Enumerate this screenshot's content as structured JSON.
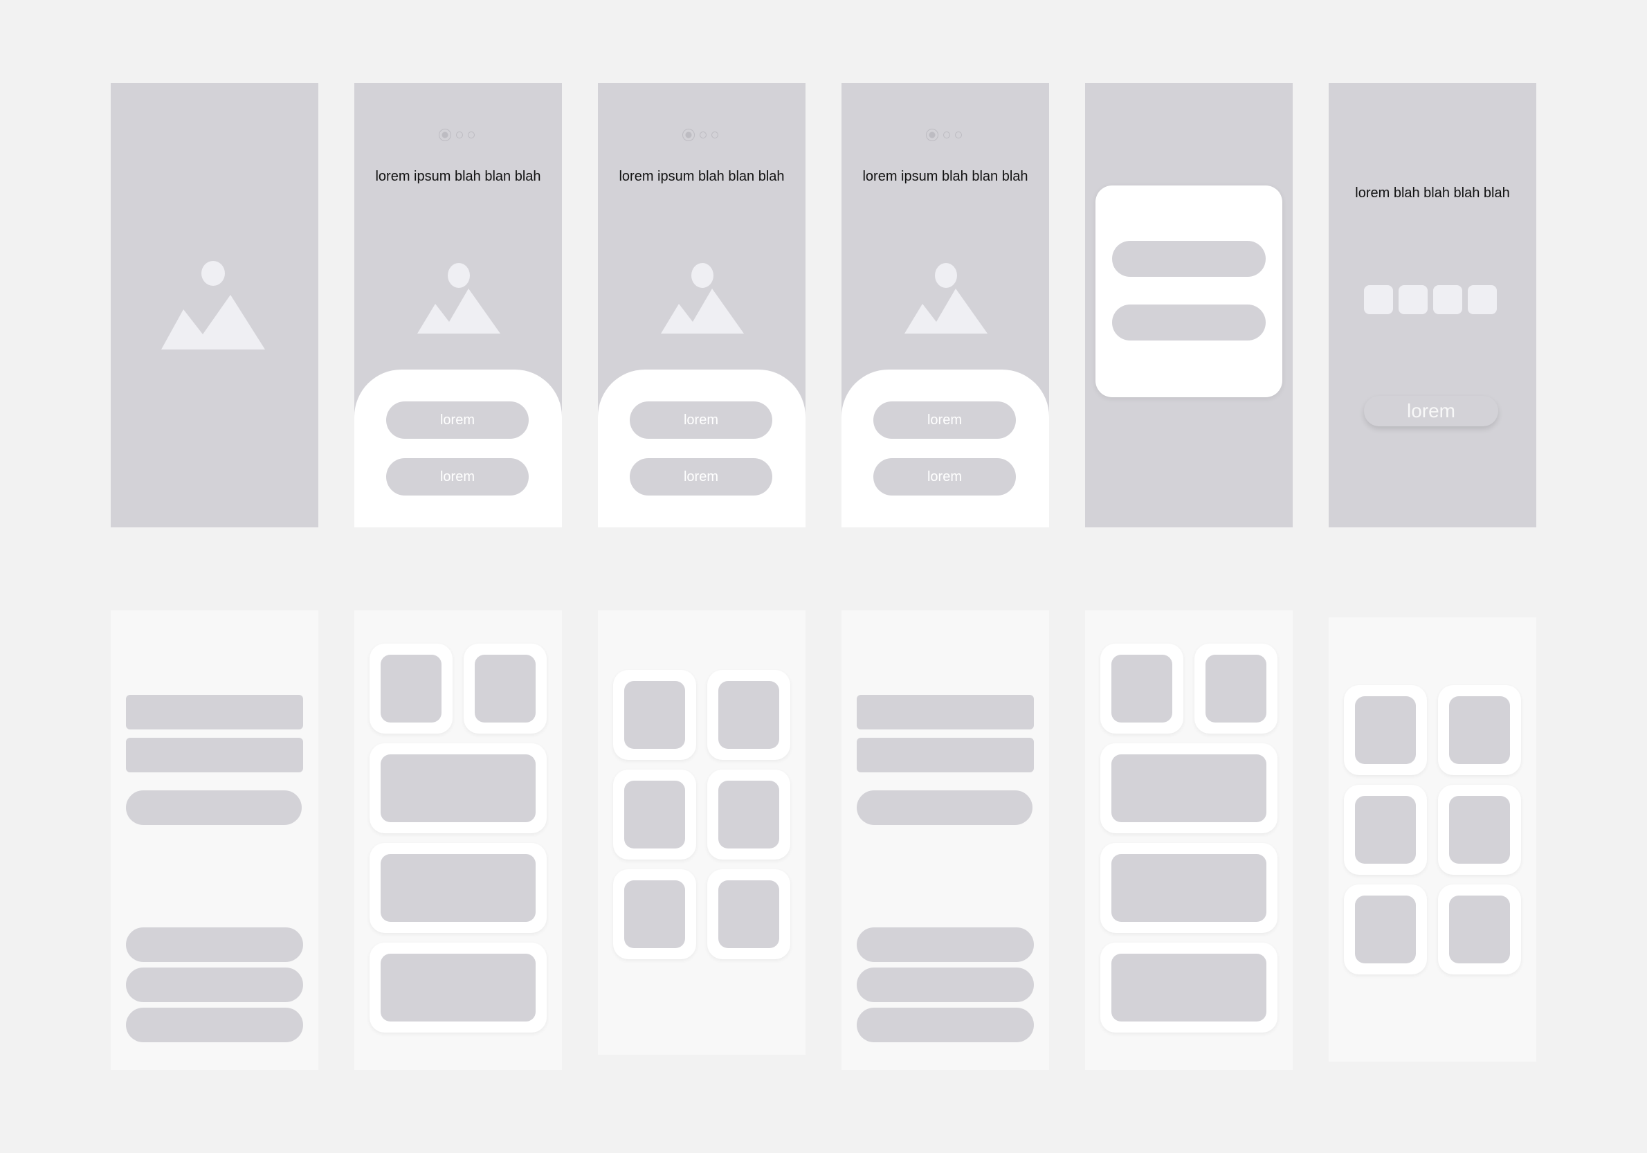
{
  "screens_top": {
    "onboarding_1": {
      "dots": 3,
      "title": "lorem ipsum blah blan blah",
      "primary_button": "lorem",
      "secondary_button": "lorem"
    },
    "onboarding_2": {
      "dots": 3,
      "title": "lorem ipsum blah blan blah",
      "primary_button": "lorem",
      "secondary_button": "lorem"
    },
    "onboarding_3": {
      "dots": 3,
      "title": "lorem ipsum blah blan blah",
      "primary_button": "lorem",
      "secondary_button": "lorem"
    },
    "verification": {
      "title": "lorem blah blah blah blah",
      "code_boxes": 4,
      "submit_button": "lorem"
    }
  },
  "colors": {
    "background": "#f2f2f2",
    "placeholder": "#d3d2d7",
    "light_screen": "#f8f8f8",
    "card": "#ffffff",
    "image_icon": "#efeff3"
  },
  "icons": {
    "image_placeholder": "image-icon"
  }
}
